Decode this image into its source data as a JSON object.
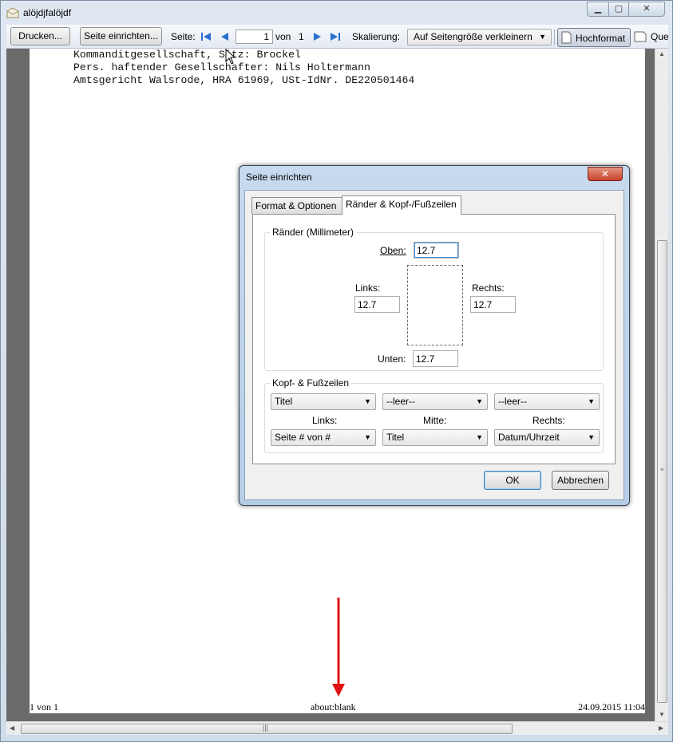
{
  "window": {
    "title": "alöjdjfalöjdf",
    "icon": "envelope-icon"
  },
  "toolbar": {
    "print_label": "Drucken...",
    "page_setup_label": "Seite einrichten...",
    "page_label": "Seite:",
    "page_value": "1",
    "of_label": "von",
    "total_pages": "1",
    "scaling_label": "Skalierung:",
    "scaling_value": "Auf Seitengröße verkleinern",
    "portrait_label": "Hochformat",
    "landscape_label": "Que"
  },
  "document": {
    "lines": [
      "Kommanditgesellschaft, Sitz: Brockel",
      "Pers. haftender Gesellschafter: Nils Holtermann",
      "Amtsgericht Walsrode, HRA 61969, USt-IdNr. DE220501464"
    ],
    "footer_left": "1 von 1",
    "footer_center": "about:blank",
    "footer_right": "24.09.2015 11:04"
  },
  "dialog": {
    "title": "Seite einrichten",
    "tabs": [
      "Format & Optionen",
      "Ränder & Kopf-/Fußzeilen"
    ],
    "margins": {
      "legend": "Ränder (Millimeter)",
      "top_label": "Oben:",
      "top_value": "12.7",
      "left_label": "Links:",
      "left_value": "12.7",
      "right_label": "Rechts:",
      "right_value": "12.7",
      "bottom_label": "Unten:",
      "bottom_value": "12.7"
    },
    "headers": {
      "legend": "Kopf- & Fußzeilen",
      "header_left": "Titel",
      "header_center": "--leer--",
      "header_right": "--leer--",
      "col_left": "Links:",
      "col_center": "Mitte:",
      "col_right": "Rechts:",
      "footer_left": "Seite # von #",
      "footer_center": "Titel",
      "footer_right": "Datum/Uhrzeit"
    },
    "ok_label": "OK",
    "cancel_label": "Abbrechen"
  },
  "annotation": {
    "color": "#e01010"
  }
}
